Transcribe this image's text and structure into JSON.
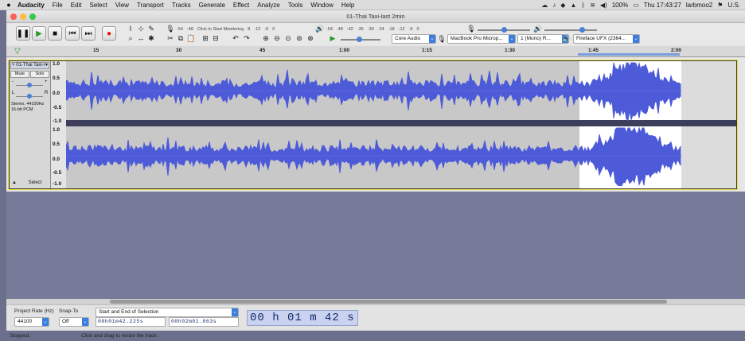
{
  "menubar": {
    "app": "Audacity",
    "items": [
      "File",
      "Edit",
      "Select",
      "View",
      "Transport",
      "Tracks",
      "Generate",
      "Effect",
      "Analyze",
      "Tools",
      "Window",
      "Help"
    ],
    "battery": "100%",
    "clock": "Thu 17:43:27",
    "user": "larbmoo2",
    "locale": "U.S."
  },
  "window": {
    "title": "01-Thai Taxi-last 2min"
  },
  "meters": {
    "record_hint": "Click to Start Monitoring",
    "rec_ticks": [
      "-54",
      "-48",
      "8",
      "-12",
      "-6",
      "0"
    ],
    "play_ticks": [
      "-54",
      "-48",
      "-42",
      "-36",
      "-30",
      "-24",
      "-18",
      "-12",
      "-6",
      "0"
    ]
  },
  "device": {
    "host": "Core Audio",
    "input": "MacBook Pro Microp...",
    "channels": "1 (Mono) R...",
    "output": "Fireface UFX (2364..."
  },
  "ruler": {
    "ticks": [
      "15",
      "30",
      "45",
      "1:00",
      "1:15",
      "1:30",
      "1:45",
      "2:00"
    ]
  },
  "track": {
    "name": "01-Thai Taxi-l",
    "mute": "Mute",
    "solo": "Solo",
    "info1": "Stereo, 44100Hz",
    "info2": "16-bit PCM",
    "select": "Select",
    "gain_minus": "-",
    "gain_plus": "+",
    "pan_l": "L",
    "pan_r": "R",
    "scale": [
      "1.0",
      "0.5",
      "0.0",
      "-0.5",
      "-1.0"
    ]
  },
  "bottom": {
    "rate_label": "Project Rate (Hz)",
    "rate": "44100",
    "snap_label": "Snap-To",
    "snap": "Off",
    "sel_mode": "Start and End of Selection",
    "sel_start": "00h01m42.225s",
    "sel_end": "00h02m01.063s",
    "position": "00 h 01 m 42 s"
  },
  "status": {
    "state": "Stopped.",
    "hint": "Click and drag to resize the track."
  }
}
